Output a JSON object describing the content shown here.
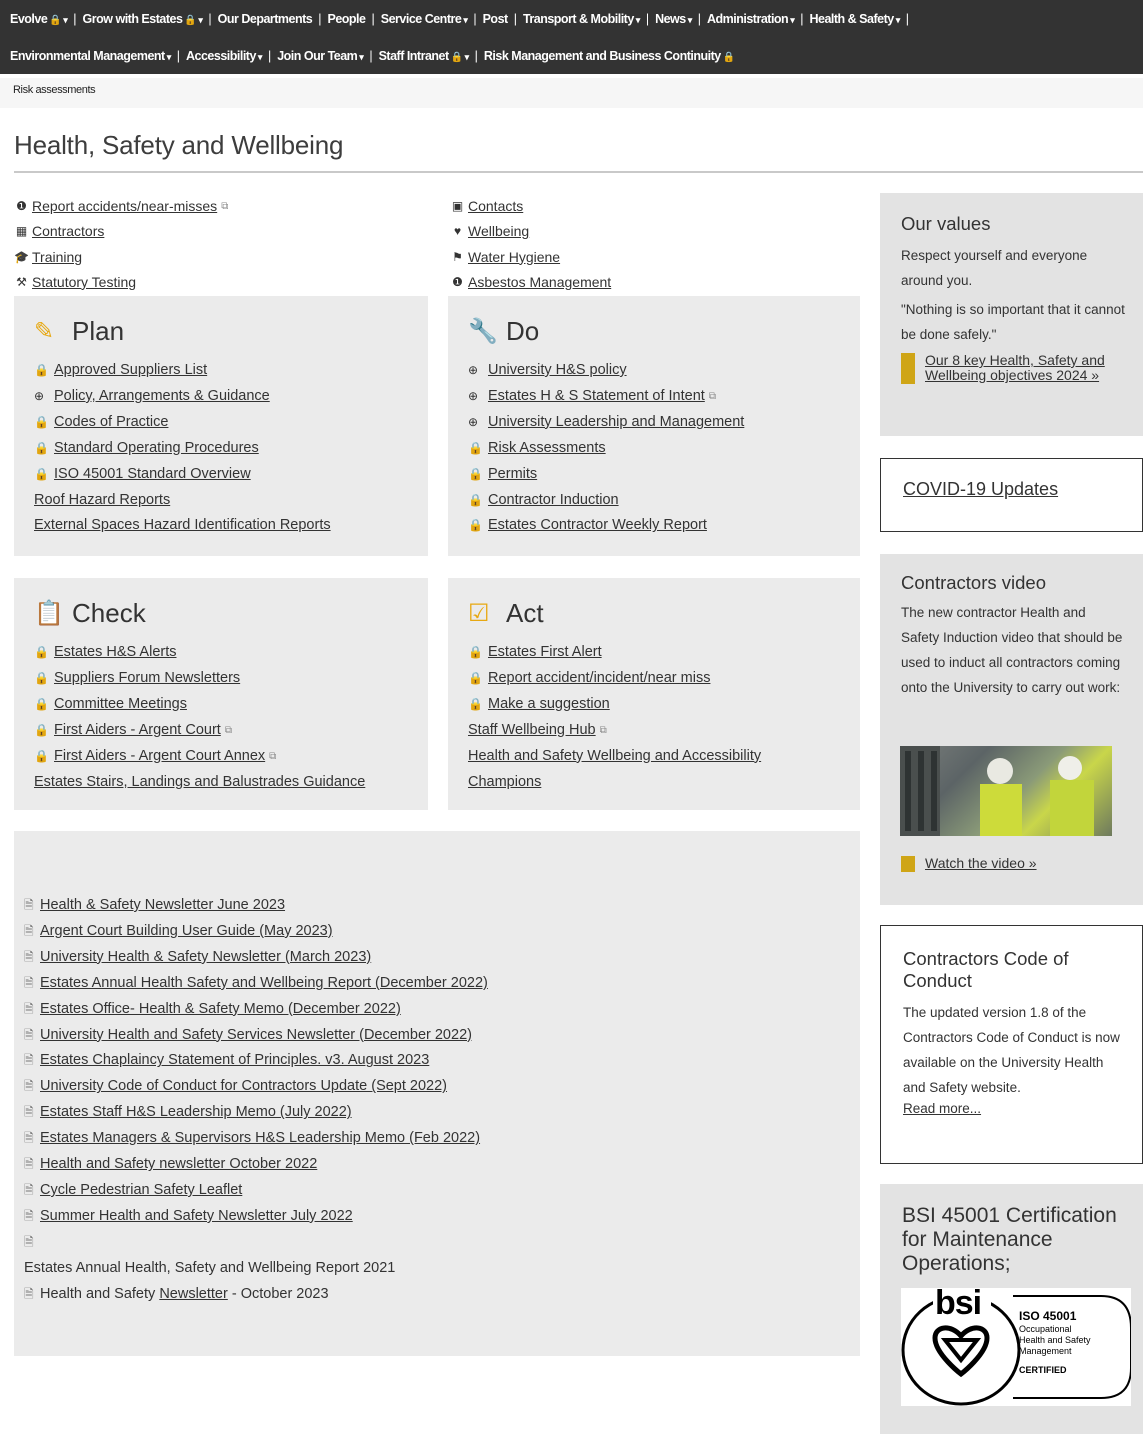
{
  "topnav": {
    "row1": [
      {
        "label": "Evolve",
        "lock": true,
        "caret": true
      },
      {
        "label": "Grow with Estates",
        "lock": true,
        "caret": true
      },
      {
        "label": "Our Departments",
        "lock": false,
        "caret": false
      },
      {
        "label": "People",
        "lock": false,
        "caret": false
      },
      {
        "label": "Service Centre",
        "lock": false,
        "caret": true
      },
      {
        "label": "Post",
        "lock": false,
        "caret": false
      },
      {
        "label": "Transport & Mobility",
        "lock": false,
        "caret": true
      },
      {
        "label": "News",
        "lock": false,
        "caret": true
      },
      {
        "label": "Administration",
        "lock": false,
        "caret": true
      },
      {
        "label": "Health & Safety",
        "lock": false,
        "caret": true
      }
    ],
    "row2": [
      {
        "label": "Environmental Management",
        "lock": false,
        "caret": true
      },
      {
        "label": "Accessibility",
        "lock": false,
        "caret": true
      },
      {
        "label": "Join Our Team",
        "lock": false,
        "caret": true
      },
      {
        "label": "Staff Intranet",
        "lock": true,
        "caret": true
      },
      {
        "label": "Risk Management and Business Continuity",
        "lock": true,
        "caret": false
      }
    ]
  },
  "breadcrumb": "Risk assessments",
  "page_title": "Health, Safety and Wellbeing",
  "quicklinks_left": [
    {
      "icon": "alert-icon",
      "glyph": "❶",
      "label": "Report accidents/near-misses",
      "external": true
    },
    {
      "icon": "building-icon",
      "glyph": "▦",
      "label": "Contractors",
      "external": false
    },
    {
      "icon": "graduation-cap-icon",
      "glyph": "🎓",
      "label": "Training",
      "external": false
    },
    {
      "icon": "wrench-icon",
      "glyph": "⚒",
      "label": "Statutory Testing",
      "external": false
    }
  ],
  "quicklinks_right": [
    {
      "icon": "contact-card-icon",
      "glyph": "▣",
      "label": "Contacts",
      "external": false
    },
    {
      "icon": "heart-icon",
      "glyph": "♥",
      "label": "Wellbeing",
      "external": false
    },
    {
      "icon": "flag-icon",
      "glyph": "⚑",
      "label": "Water Hygiene",
      "external": false
    },
    {
      "icon": "info-icon",
      "glyph": "❶",
      "label": "Asbestos Management",
      "external": false
    }
  ],
  "plan": {
    "title": "Plan",
    "items": [
      {
        "icon": "lock",
        "label": "Approved Suppliers List"
      },
      {
        "icon": "globe",
        "label": "Policy, Arrangements & Guidance"
      },
      {
        "icon": "lock",
        "label": "Codes of Practice"
      },
      {
        "icon": "lock",
        "label": "Standard Operating Procedures"
      },
      {
        "icon": "lock",
        "label": "ISO 45001 Standard Overview"
      },
      {
        "icon": "none",
        "label": "Roof Hazard Reports"
      },
      {
        "icon": "none",
        "label": "External Spaces Hazard Identification Reports"
      }
    ]
  },
  "do": {
    "title": "Do",
    "items": [
      {
        "icon": "globe",
        "label": "University H&S policy",
        "external": false
      },
      {
        "icon": "globe",
        "label": "Estates H & S Statement of Intent",
        "external": true
      },
      {
        "icon": "globe",
        "label": "University Leadership and Management",
        "external": false
      },
      {
        "icon": "lock",
        "label": "Risk Assessments",
        "external": false
      },
      {
        "icon": "lock",
        "label": "Permits",
        "external": false
      },
      {
        "icon": "lock",
        "label": "Contractor Induction",
        "external": false
      },
      {
        "icon": "lock",
        "label": "Estates Contractor Weekly Report",
        "external": false
      }
    ]
  },
  "check": {
    "title": "Check",
    "items": [
      {
        "icon": "lock",
        "label": "Estates H&S Alerts",
        "external": false
      },
      {
        "icon": "lock",
        "label": "Suppliers Forum Newsletters",
        "external": false
      },
      {
        "icon": "lock",
        "label": "Committee Meetings",
        "external": false
      },
      {
        "icon": "lock",
        "label": "First Aiders - Argent Court",
        "external": true
      },
      {
        "icon": "lock",
        "label": "First Aiders - Argent Court Annex",
        "external": true
      },
      {
        "icon": "none",
        "label": "Estates Stairs, Landings and Balustrades Guidance",
        "external": false
      }
    ]
  },
  "act": {
    "title": "Act",
    "items": [
      {
        "icon": "lock",
        "label": "Estates First Alert",
        "external": false
      },
      {
        "icon": "lock",
        "label": "Report accident/incident/near miss",
        "external": false
      },
      {
        "icon": "lock",
        "label": "Make a suggestion",
        "external": false
      },
      {
        "icon": "none",
        "label": "Staff Wellbeing Hub",
        "external": true
      },
      {
        "icon": "none",
        "label": "Health and Safety Wellbeing and Accessibility",
        "external": false
      },
      {
        "icon": "none",
        "label": "Champions",
        "external": false
      }
    ]
  },
  "newsletters": [
    "Health & Safety Newsletter June 2023",
    "Argent Court Building User Guide (May 2023)",
    "University Health & Safety Newsletter (March 2023)",
    "Estates Annual Health Safety and Wellbeing Report (December 2022)",
    "Estates Office- Health & Safety Memo (December 2022)",
    "University Health and Safety Services Newsletter (December 2022)",
    "Estates Chaplaincy Statement of Principles. v3. August 2023",
    "University Code of Conduct for Contractors Update (Sept 2022)",
    "Estates Staff H&S Leadership Memo (July 2022)",
    "Estates Managers & Supervisors H&S Leadership Memo (Feb 2022)",
    "Health and Safety newsletter October 2022",
    "Cycle Pedestrian Safety Leaflet",
    "Summer Health and Safety Newsletter July 2022"
  ],
  "annual_report_label": "Estates Annual Health, Safety and Wellbeing Report 2021",
  "last_newsletter": {
    "prefix": "Health and Safety ",
    "link": "Newsletter",
    "suffix": " - October 2023"
  },
  "values": {
    "title": "Our values",
    "text1": "Respect yourself and everyone around you.",
    "text2": "\"Nothing is so important that it cannot be done safely.\"",
    "link": "Our 8 key Health, Safety and Wellbeing objectives 2024 »"
  },
  "covid": {
    "label": "COVID-19 Updates"
  },
  "video": {
    "title": "Contractors video",
    "text": "The new contractor Health and Safety Induction video that should be used to induct all contractors coming onto the University to carry out work:",
    "link": "Watch the video »"
  },
  "code": {
    "title": "Contractors Code of Conduct",
    "text": "The updated version 1.8 of the Contractors Code of Conduct is now available on the University Health and Safety website.",
    "link": "Read more..."
  },
  "bsi": {
    "title": "BSI 45001 Certification for Maintenance Operations;",
    "logo_word": "bsi",
    "cert_lines": [
      "ISO 45001",
      "Occupational",
      "Health and Safety",
      "Management",
      "CERTIFIED"
    ]
  },
  "colors": {
    "accent": "#e7a812",
    "nav_bg": "#333333",
    "panel_bg": "#ebebeb"
  }
}
